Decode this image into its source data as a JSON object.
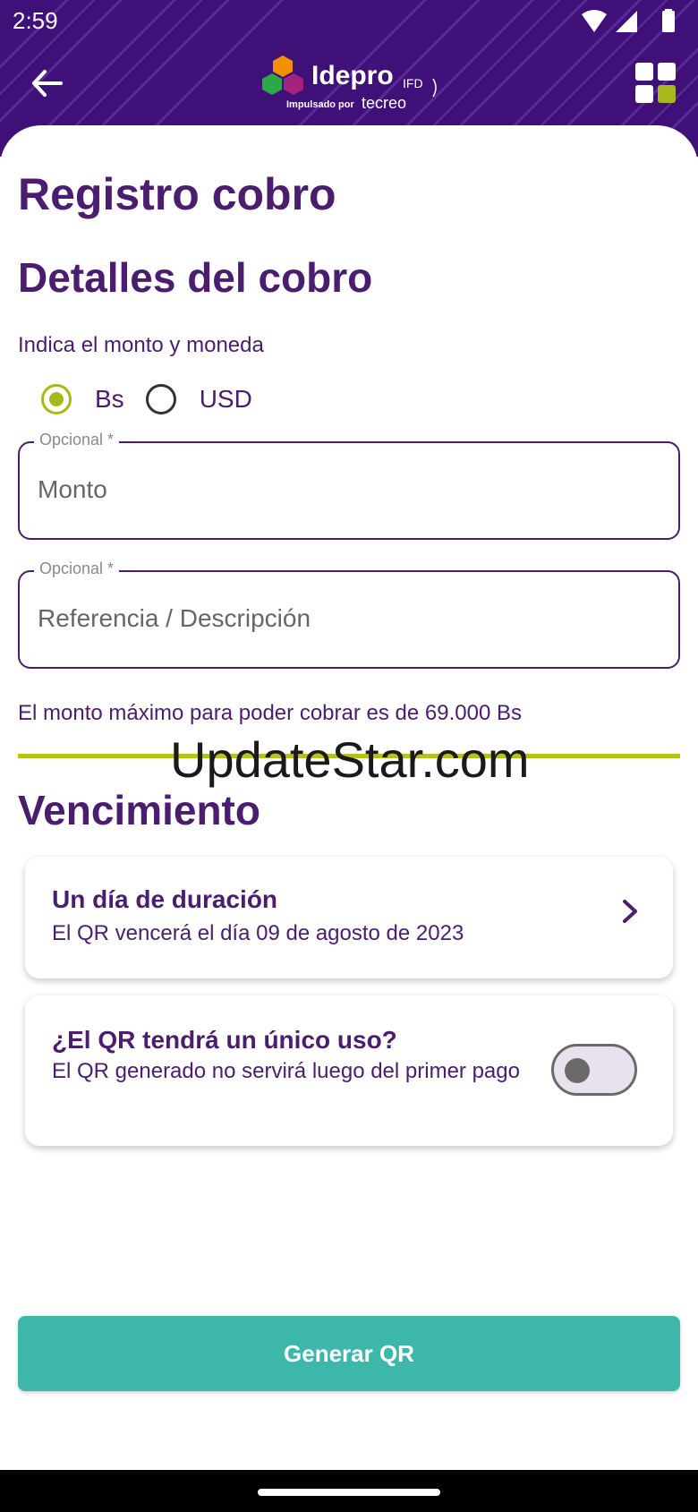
{
  "status_bar": {
    "time": "2:59",
    "icons": [
      "wifi-icon",
      "cellular-signal-icon",
      "battery-icon"
    ]
  },
  "header": {
    "back_icon": "arrow-left-icon",
    "logo_brand": "Idepro",
    "logo_suffix": "IFD",
    "logo_tagline_prefix": "Impulsado por",
    "logo_tagline_brand": "tecreo",
    "menu_icon": "grid-icon",
    "colors": {
      "background": "#3f1178",
      "accent": "#a7b81a"
    }
  },
  "page_title": "Registro cobro",
  "details": {
    "title": "Detalles del cobro",
    "instruction": "Indica el monto y moneda",
    "currency_options": [
      {
        "label": "Bs",
        "selected": true
      },
      {
        "label": "USD",
        "selected": false
      }
    ],
    "amount_field": {
      "legend": "Opcional *",
      "placeholder": "Monto",
      "value": ""
    },
    "reference_field": {
      "legend": "Opcional *",
      "placeholder": "Referencia / Descripción",
      "value": ""
    },
    "max_note": "El monto máximo para poder cobrar es de 69.000 Bs"
  },
  "watermark": "UpdateStar.com",
  "expiration": {
    "title": "Vencimiento",
    "duration_card": {
      "title": "Un día de duración",
      "subtitle": "El QR vencerá el día 09 de agosto de 2023",
      "icon": "chevron-right-icon"
    },
    "single_use_card": {
      "title": "¿El QR tendrá un único uso?",
      "subtitle": "El QR generado no servirá luego del primer pago",
      "toggle_on": false
    }
  },
  "primary_button": {
    "label": "Generar QR",
    "color": "#3db7aa"
  },
  "colors": {
    "primary_text": "#4a1d6e",
    "accent": "#a7b81a",
    "divider": "#b5c21d"
  }
}
